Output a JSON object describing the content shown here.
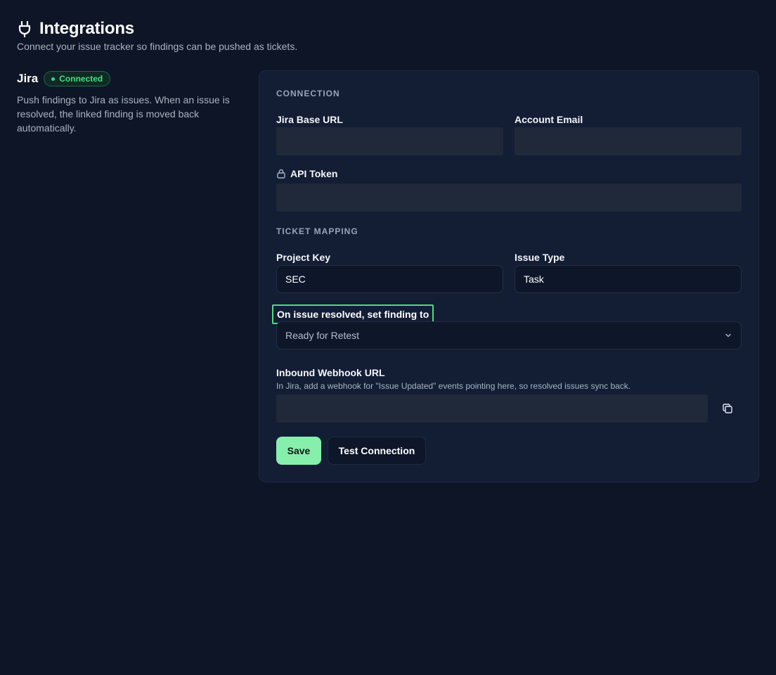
{
  "header": {
    "title": "Integrations",
    "subtitle": "Connect your issue tracker so findings can be pushed as tickets.",
    "icon": "plug-icon"
  },
  "provider": {
    "name": "Jira",
    "status": "Connected",
    "description": "Push findings to Jira as issues. When an issue is resolved, the linked finding is moved back automatically."
  },
  "connection": {
    "section_label": "CONNECTION",
    "base_url_label": "Jira Base URL",
    "base_url_value": "",
    "email_label": "Account Email",
    "email_value": "",
    "token_label": "API Token",
    "token_icon": "lock-icon",
    "token_value": ""
  },
  "mapping": {
    "section_label": "TICKET MAPPING",
    "project_key_label": "Project Key",
    "project_key_value": "SEC",
    "issue_type_label": "Issue Type",
    "issue_type_value": "Task",
    "resolved_label": "On issue resolved, set finding to",
    "resolved_value": "Ready for Retest"
  },
  "webhook": {
    "label": "Inbound Webhook URL",
    "helper": "In Jira, add a webhook for \"Issue Updated\" events pointing here, so resolved issues sync back.",
    "value": "",
    "copy_icon": "copy-icon"
  },
  "actions": {
    "save_label": "Save",
    "test_label": "Test Connection"
  },
  "colors": {
    "background": "#0d1526",
    "card": "#131d34",
    "accent": "#86efac",
    "status": "#4ade80"
  }
}
